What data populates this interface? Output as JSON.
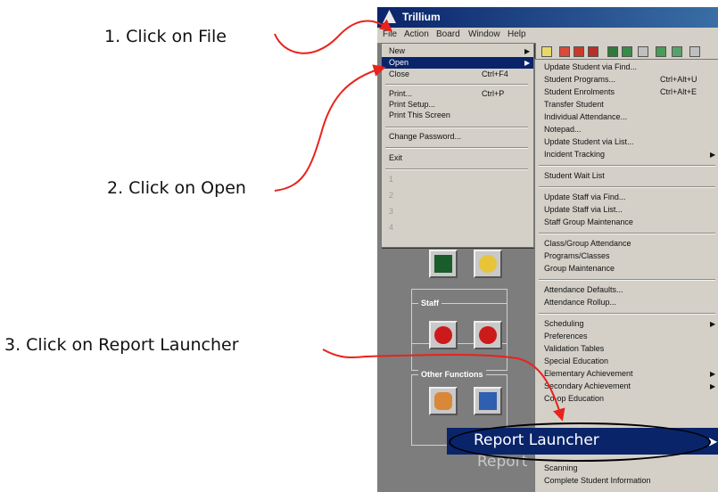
{
  "callouts": {
    "step1": "1. Click on File",
    "step2": "2. Click on Open",
    "step3": "3. Click on Report Launcher"
  },
  "app": {
    "title": "Trillium",
    "menubar": [
      "File",
      "Action",
      "Board",
      "Window",
      "Help"
    ]
  },
  "file_menu": {
    "items": [
      {
        "label": "New",
        "shortcut": "",
        "submenu": true
      },
      {
        "label": "Open",
        "shortcut": "",
        "submenu": true,
        "selected": true
      },
      {
        "label": "Close",
        "shortcut": "Ctrl+F4"
      },
      {
        "label": "Print...",
        "shortcut": "Ctrl+P"
      },
      {
        "label": "Print Setup..."
      },
      {
        "label": "Print This Screen"
      },
      {
        "label": "Change Password..."
      },
      {
        "label": "Exit"
      },
      {
        "label": "1"
      },
      {
        "label": "2"
      },
      {
        "label": "3"
      },
      {
        "label": "4"
      }
    ]
  },
  "open_menu": {
    "items": [
      {
        "label": "Update Student via Find..."
      },
      {
        "label": "Student Programs...",
        "shortcut": "Ctrl+Alt+U"
      },
      {
        "label": "Student Enrolments",
        "shortcut": "Ctrl+Alt+E"
      },
      {
        "label": "Transfer Student"
      },
      {
        "label": "Individual Attendance..."
      },
      {
        "label": "Notepad..."
      },
      {
        "label": "Update Student via List..."
      },
      {
        "label": "Incident Tracking",
        "submenu": true
      },
      {
        "label": "Student Wait List"
      },
      {
        "label": "Update Staff via Find..."
      },
      {
        "label": "Update Staff via List..."
      },
      {
        "label": "Staff Group Maintenance"
      },
      {
        "label": "Class/Group Attendance"
      },
      {
        "label": "Programs/Classes"
      },
      {
        "label": "Group Maintenance"
      },
      {
        "label": "Attendance Defaults..."
      },
      {
        "label": "Attendance Rollup..."
      },
      {
        "label": "Scheduling",
        "submenu": true
      },
      {
        "label": "Preferences"
      },
      {
        "label": "Validation Tables"
      },
      {
        "label": "Special Education"
      },
      {
        "label": "Elementary Achievement",
        "submenu": true
      },
      {
        "label": "Secondary Achievement",
        "submenu": true
      },
      {
        "label": "Co-op Education"
      },
      {
        "label": "Scanning"
      },
      {
        "label": "Complete Student Information"
      }
    ],
    "highlighted": {
      "label": "Report Launcher",
      "ghost": "Report"
    }
  },
  "workspace": {
    "groups": {
      "staff": "Staff",
      "other": "Other Functions"
    }
  },
  "colors": {
    "title_bar": "#0a246a",
    "menu_bg": "#d4d0c8",
    "highlight": "#0a246a",
    "arrow": "#e8231c",
    "workspace": "#7d7d7d"
  }
}
